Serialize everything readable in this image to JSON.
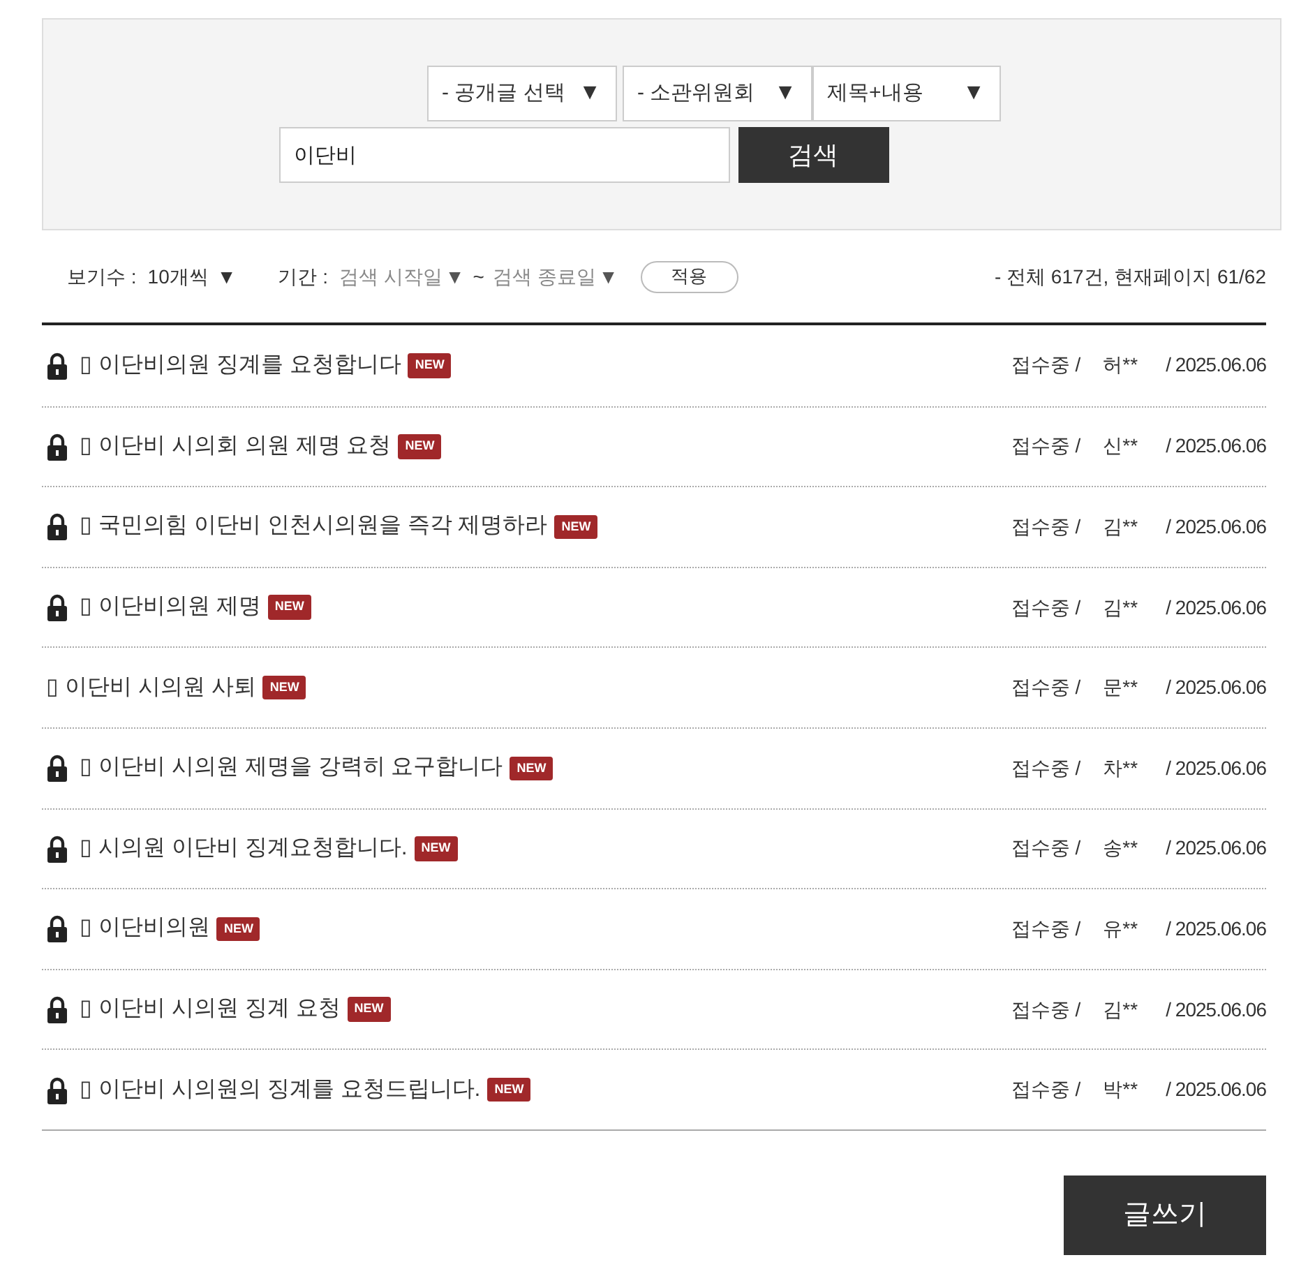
{
  "search": {
    "selects": [
      {
        "label": "- 공개글 선택",
        "arrow": "▼"
      },
      {
        "label": "- 소관위원회",
        "arrow": "▼"
      },
      {
        "label": "제목+내용",
        "arrow": "▼"
      }
    ],
    "query": "이단비",
    "button": "검색"
  },
  "toolbar": {
    "per_page_label": "보기수 :",
    "per_page": "10개씩",
    "per_page_arrow": "▼",
    "period_label": "기간 :",
    "start_placeholder": "검색 시작일",
    "start_arrow": "▼",
    "tilde": "~",
    "end_placeholder": "검색 종료일",
    "end_arrow": "▼",
    "apply": "적용",
    "summary": "- 전체 617건, 현재페이지 61/62"
  },
  "posts": [
    {
      "locked": true,
      "title": "▯ 이단비의원 징계를 요청합니다",
      "badge": "NEW",
      "status": "접수중 /",
      "author": "허**",
      "date": "/ 2025.06.06"
    },
    {
      "locked": true,
      "title": "▯ 이단비 시의회 의원 제명 요청",
      "badge": "NEW",
      "status": "접수중 /",
      "author": "신**",
      "date": "/ 2025.06.06"
    },
    {
      "locked": true,
      "title": "▯ 국민의힘 이단비 인천시의원을 즉각 제명하라",
      "badge": "NEW",
      "status": "접수중 /",
      "author": "김**",
      "date": "/ 2025.06.06"
    },
    {
      "locked": true,
      "title": "▯ 이단비의원 제명",
      "badge": "NEW",
      "status": "접수중 /",
      "author": "김**",
      "date": "/ 2025.06.06"
    },
    {
      "locked": false,
      "title": "▯ 이단비 시의원 사퇴",
      "badge": "NEW",
      "status": "접수중 /",
      "author": "문**",
      "date": "/ 2025.06.06"
    },
    {
      "locked": true,
      "title": "▯ 이단비 시의원 제명을 강력히 요구합니다",
      "badge": "NEW",
      "status": "접수중 /",
      "author": "차**",
      "date": "/ 2025.06.06"
    },
    {
      "locked": true,
      "title": "▯ 시의원 이단비 징계요청합니다.",
      "badge": "NEW",
      "status": "접수중 /",
      "author": "송**",
      "date": "/ 2025.06.06"
    },
    {
      "locked": true,
      "title": "▯ 이단비의원",
      "badge": "NEW",
      "status": "접수중 /",
      "author": "유**",
      "date": "/ 2025.06.06"
    },
    {
      "locked": true,
      "title": "▯ 이단비 시의원 징계 요청",
      "badge": "NEW",
      "status": "접수중 /",
      "author": "김**",
      "date": "/ 2025.06.06"
    },
    {
      "locked": true,
      "title": "▯ 이단비 시의원의 징계를 요청드립니다.",
      "badge": "NEW",
      "status": "접수중 /",
      "author": "박**",
      "date": "/ 2025.06.06"
    }
  ],
  "write_button": "글쓰기"
}
